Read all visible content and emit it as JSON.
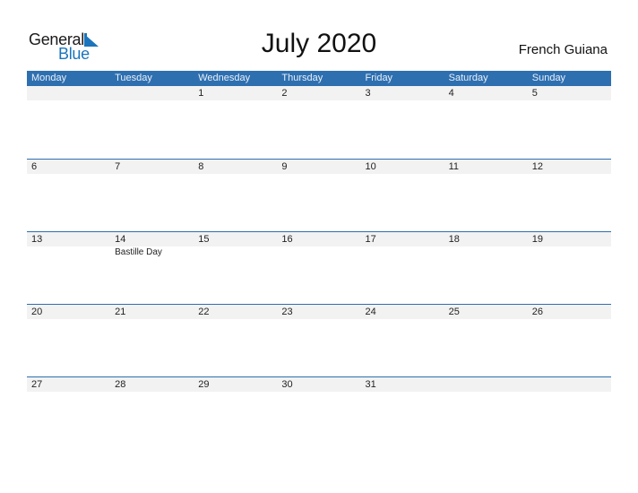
{
  "logo": {
    "word1": "General",
    "word2": "Blue"
  },
  "header": {
    "title": "July 2020",
    "country": "French Guiana"
  },
  "calendar": {
    "weekdays": [
      "Monday",
      "Tuesday",
      "Wednesday",
      "Thursday",
      "Friday",
      "Saturday",
      "Sunday"
    ],
    "weeks": [
      {
        "days": [
          "",
          "",
          "1",
          "2",
          "3",
          "4",
          "5"
        ],
        "events": [
          "",
          "",
          "",
          "",
          "",
          "",
          ""
        ]
      },
      {
        "days": [
          "6",
          "7",
          "8",
          "9",
          "10",
          "11",
          "12"
        ],
        "events": [
          "",
          "",
          "",
          "",
          "",
          "",
          ""
        ]
      },
      {
        "days": [
          "13",
          "14",
          "15",
          "16",
          "17",
          "18",
          "19"
        ],
        "events": [
          "",
          "Bastille Day",
          "",
          "",
          "",
          "",
          ""
        ]
      },
      {
        "days": [
          "20",
          "21",
          "22",
          "23",
          "24",
          "25",
          "26"
        ],
        "events": [
          "",
          "",
          "",
          "",
          "",
          "",
          ""
        ]
      },
      {
        "days": [
          "27",
          "28",
          "29",
          "30",
          "31",
          "",
          ""
        ],
        "events": [
          "",
          "",
          "",
          "",
          "",
          "",
          ""
        ]
      }
    ]
  },
  "colors": {
    "header_bg": "#2e6fb0",
    "brand_blue": "#1b75bc",
    "day_row_bg": "#f2f2f2"
  }
}
